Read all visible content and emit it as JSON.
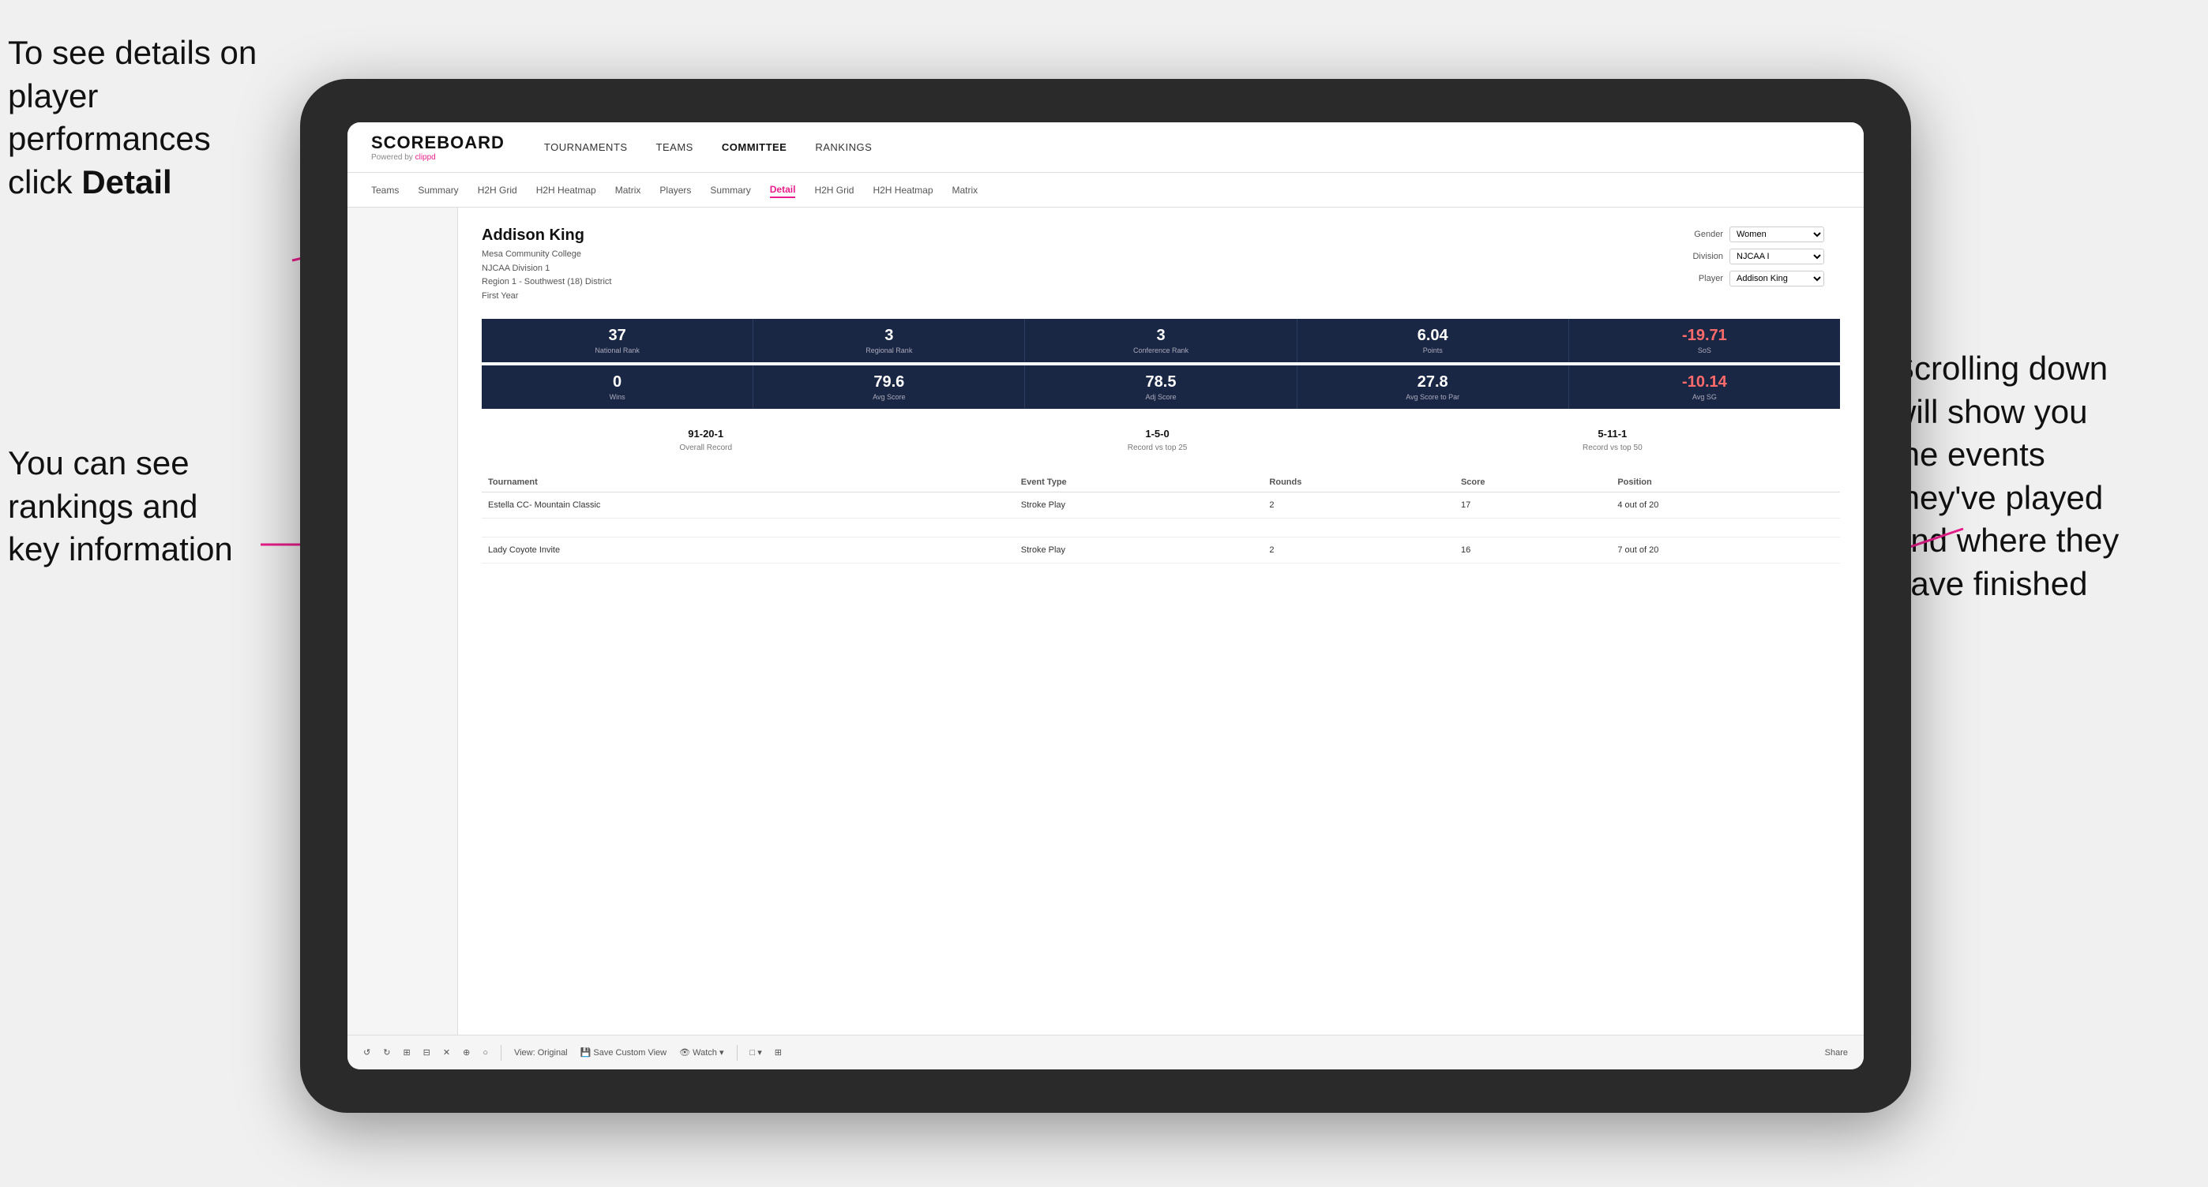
{
  "annotations": {
    "top_left": "To see details on player performances click ",
    "top_left_bold": "Detail",
    "bottom_left_line1": "You can see",
    "bottom_left_line2": "rankings and",
    "bottom_left_line3": "key information",
    "right_line1": "Scrolling down",
    "right_line2": "will show you",
    "right_line3": "the events",
    "right_line4": "they've played",
    "right_line5": "and where they",
    "right_line6": "have finished"
  },
  "nav": {
    "logo": "SCOREBOARD",
    "logo_sub": "Powered by clippd",
    "items": [
      "TOURNAMENTS",
      "TEAMS",
      "COMMITTEE",
      "RANKINGS"
    ],
    "active_item": "COMMITTEE"
  },
  "sub_nav": {
    "items": [
      "Teams",
      "Summary",
      "H2H Grid",
      "H2H Heatmap",
      "Matrix",
      "Players",
      "Summary",
      "Detail",
      "H2H Grid",
      "H2H Heatmap",
      "Matrix"
    ],
    "active_item": "Detail"
  },
  "player": {
    "name": "Addison King",
    "college": "Mesa Community College",
    "division": "NJCAA Division 1",
    "region": "Region 1 - Southwest (18) District",
    "year": "First Year"
  },
  "filters": {
    "gender_label": "Gender",
    "gender_value": "Women",
    "division_label": "Division",
    "division_value": "NJCAA I",
    "player_label": "Player",
    "player_value": "Addison King"
  },
  "stats_row1": [
    {
      "value": "37",
      "label": "National Rank"
    },
    {
      "value": "3",
      "label": "Regional Rank"
    },
    {
      "value": "3",
      "label": "Conference Rank"
    },
    {
      "value": "6.04",
      "label": "Points"
    },
    {
      "value": "-19.71",
      "label": "SoS",
      "negative": true
    }
  ],
  "stats_row2": [
    {
      "value": "0",
      "label": "Wins"
    },
    {
      "value": "79.6",
      "label": "Avg Score"
    },
    {
      "value": "78.5",
      "label": "Adj Score"
    },
    {
      "value": "27.8",
      "label": "Avg Score to Par"
    },
    {
      "value": "-10.14",
      "label": "Avg SG",
      "negative": true
    }
  ],
  "records": [
    {
      "value": "91-20-1",
      "label": "Overall Record"
    },
    {
      "value": "1-5-0",
      "label": "Record vs top 25"
    },
    {
      "value": "5-11-1",
      "label": "Record vs top 50"
    }
  ],
  "table": {
    "headers": [
      "Tournament",
      "Event Type",
      "Rounds",
      "Score",
      "Position"
    ],
    "rows": [
      {
        "tournament": "Estella CC- Mountain Classic",
        "event_type": "Stroke Play",
        "rounds": "2",
        "score": "17",
        "position": "4 out of 20"
      },
      {
        "tournament": "",
        "event_type": "",
        "rounds": "",
        "score": "",
        "position": ""
      },
      {
        "tournament": "Lady Coyote Invite",
        "event_type": "Stroke Play",
        "rounds": "2",
        "score": "16",
        "position": "7 out of 20"
      }
    ]
  },
  "toolbar": {
    "items": [
      "↺",
      "↻",
      "⊞",
      "⊟",
      "✕",
      "⊕",
      "○",
      "View: Original",
      "Save Custom View",
      "Watch ▾",
      "□ ▾",
      "⊞",
      "Share"
    ]
  }
}
